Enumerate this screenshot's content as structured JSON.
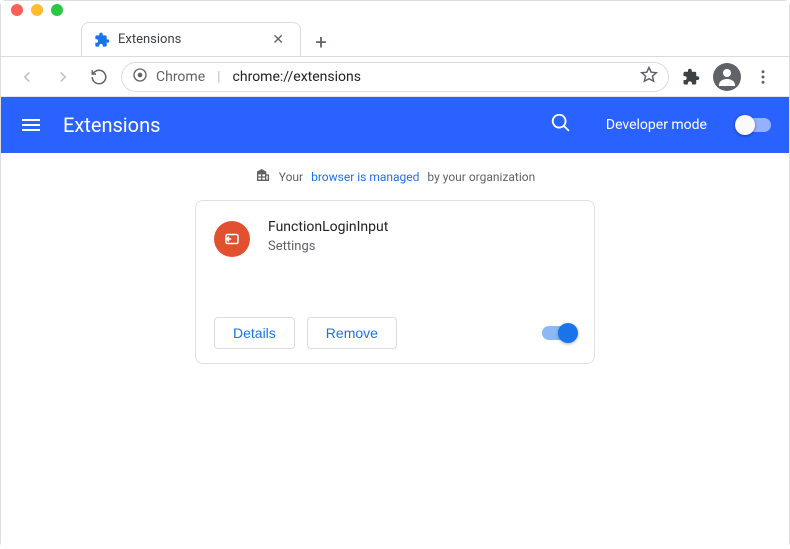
{
  "window": {
    "tab": {
      "title": "Extensions"
    },
    "new_tab_glyph": "+"
  },
  "toolbar": {
    "url_prefix": "Chrome",
    "url_path": "chrome://extensions"
  },
  "header": {
    "title": "Extensions",
    "dev_mode_label": "Developer mode",
    "dev_mode_on": false
  },
  "managed": {
    "prefix": "Your",
    "link": "browser is managed",
    "suffix": "by your organization"
  },
  "extension": {
    "name": "FunctionLoginInput",
    "description": "Settings",
    "details_label": "Details",
    "remove_label": "Remove",
    "enabled": true
  }
}
